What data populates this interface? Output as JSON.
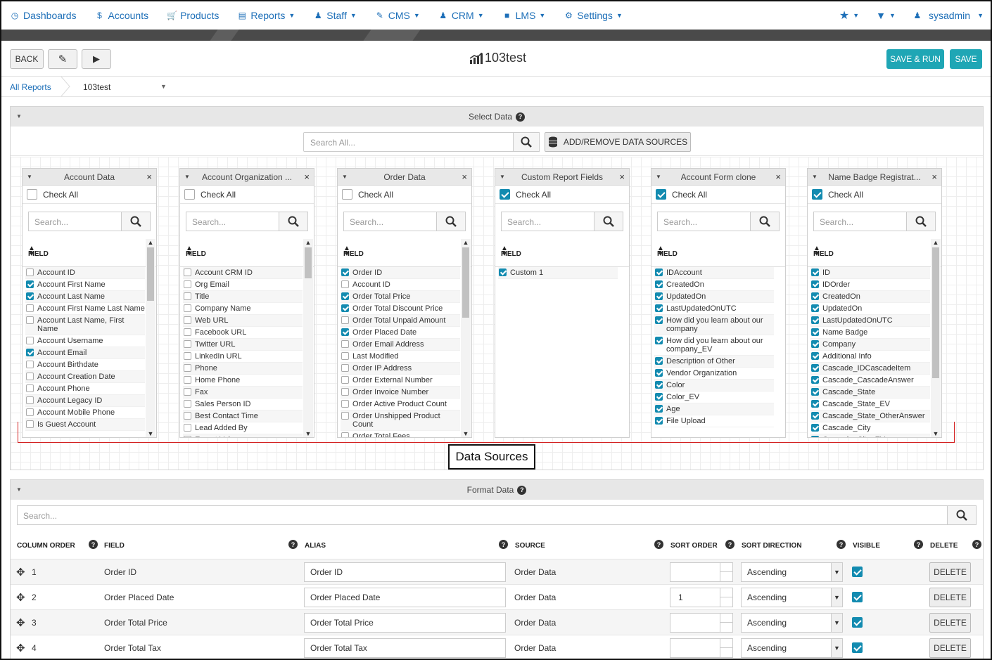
{
  "nav": {
    "items": [
      {
        "label": "Dashboards",
        "icon": "dashboard-icon",
        "dropdown": false
      },
      {
        "label": "Accounts",
        "icon": "dollar-icon",
        "dropdown": false
      },
      {
        "label": "Products",
        "icon": "cart-icon",
        "dropdown": false
      },
      {
        "label": "Reports",
        "icon": "chart-icon",
        "dropdown": true
      },
      {
        "label": "Staff",
        "icon": "user-icon",
        "dropdown": true
      },
      {
        "label": "CMS",
        "icon": "pencil-icon",
        "dropdown": true
      },
      {
        "label": "CRM",
        "icon": "users-icon",
        "dropdown": true
      },
      {
        "label": "LMS",
        "icon": "book-icon",
        "dropdown": true
      },
      {
        "label": "Settings",
        "icon": "gear-icon",
        "dropdown": true
      }
    ],
    "user": "sysadmin"
  },
  "toolbar": {
    "back_label": "BACK",
    "title": "103test",
    "save_run_label": "SAVE & RUN",
    "save_label": "SAVE"
  },
  "breadcrumb": {
    "root": "All Reports",
    "current": "103test"
  },
  "select_data": {
    "title": "Select Data",
    "search_placeholder": "Search All...",
    "add_remove_label": "ADD/REMOVE DATA SOURCES",
    "check_all_label": "Check All",
    "search_placeholder_small": "Search...",
    "field_header": "FIELD",
    "sources": [
      {
        "title": "Account Data",
        "check_all": false,
        "fields": [
          {
            "label": "Account ID",
            "checked": false
          },
          {
            "label": "Account First Name",
            "checked": true
          },
          {
            "label": "Account Last Name",
            "checked": true
          },
          {
            "label": "Account First Name Last Name",
            "checked": false
          },
          {
            "label": "Account Last Name, First Name",
            "checked": false
          },
          {
            "label": "Account Username",
            "checked": false
          },
          {
            "label": "Account Email",
            "checked": true
          },
          {
            "label": "Account Birthdate",
            "checked": false
          },
          {
            "label": "Account Creation Date",
            "checked": false
          },
          {
            "label": "Account Phone",
            "checked": false
          },
          {
            "label": "Account Legacy ID",
            "checked": false
          },
          {
            "label": "Account Mobile Phone",
            "checked": false
          },
          {
            "label": "Is Guest Account",
            "checked": false
          }
        ]
      },
      {
        "title": "Account Organization ...",
        "check_all": false,
        "fields": [
          {
            "label": "Account CRM ID",
            "checked": false
          },
          {
            "label": "Org Email",
            "checked": false
          },
          {
            "label": "Title",
            "checked": false
          },
          {
            "label": "Company Name",
            "checked": false
          },
          {
            "label": "Web URL",
            "checked": false
          },
          {
            "label": "Facebook URL",
            "checked": false
          },
          {
            "label": "Twitter URL",
            "checked": false
          },
          {
            "label": "LinkedIn URL",
            "checked": false
          },
          {
            "label": "Phone",
            "checked": false
          },
          {
            "label": "Home Phone",
            "checked": false
          },
          {
            "label": "Fax",
            "checked": false
          },
          {
            "label": "Sales Person ID",
            "checked": false
          },
          {
            "label": "Best Contact Time",
            "checked": false
          },
          {
            "label": "Lead Added By",
            "checked": false
          },
          {
            "label": "Export Value",
            "checked": false
          }
        ]
      },
      {
        "title": "Order Data",
        "check_all": false,
        "fields": [
          {
            "label": "Order ID",
            "checked": true
          },
          {
            "label": "Account ID",
            "checked": false
          },
          {
            "label": "Order Total Price",
            "checked": true
          },
          {
            "label": "Order Total Discount Price",
            "checked": true
          },
          {
            "label": "Order Total Unpaid Amount",
            "checked": false
          },
          {
            "label": "Order Placed Date",
            "checked": true
          },
          {
            "label": "Order Email Address",
            "checked": false
          },
          {
            "label": "Last Modified",
            "checked": false
          },
          {
            "label": "Order IP Address",
            "checked": false
          },
          {
            "label": "Order External Number",
            "checked": false
          },
          {
            "label": "Order Invoice Number",
            "checked": false
          },
          {
            "label": "Order Active Product Count",
            "checked": false
          },
          {
            "label": "Order Unshipped Product Count",
            "checked": false
          },
          {
            "label": "Order Total Fees",
            "checked": false
          }
        ]
      },
      {
        "title": "Custom Report Fields",
        "check_all": true,
        "fields": [
          {
            "label": "Custom 1",
            "checked": true
          }
        ]
      },
      {
        "title": "Account Form clone",
        "check_all": true,
        "fields": [
          {
            "label": "IDAccount",
            "checked": true
          },
          {
            "label": "CreatedOn",
            "checked": true
          },
          {
            "label": "UpdatedOn",
            "checked": true
          },
          {
            "label": "LastUpdatedOnUTC",
            "checked": true
          },
          {
            "label": "How did you learn about our company",
            "checked": true
          },
          {
            "label": "How did you learn about our company_EV",
            "checked": true
          },
          {
            "label": "Description of Other",
            "checked": true
          },
          {
            "label": "Vendor Organization",
            "checked": true
          },
          {
            "label": "Color",
            "checked": true
          },
          {
            "label": "Color_EV",
            "checked": true
          },
          {
            "label": "Age",
            "checked": true
          },
          {
            "label": "File Upload",
            "checked": true
          }
        ]
      },
      {
        "title": "Name Badge Registrat...",
        "check_all": true,
        "fields": [
          {
            "label": "ID",
            "checked": true
          },
          {
            "label": "IDOrder",
            "checked": true
          },
          {
            "label": "CreatedOn",
            "checked": true
          },
          {
            "label": "UpdatedOn",
            "checked": true
          },
          {
            "label": "LastUpdatedOnUTC",
            "checked": true
          },
          {
            "label": "Name Badge",
            "checked": true
          },
          {
            "label": "Company",
            "checked": true
          },
          {
            "label": "Additional Info",
            "checked": true
          },
          {
            "label": "Cascade_IDCascadeItem",
            "checked": true
          },
          {
            "label": "Cascade_CascadeAnswer",
            "checked": true
          },
          {
            "label": "Cascade_State",
            "checked": true
          },
          {
            "label": "Cascade_State_EV",
            "checked": true
          },
          {
            "label": "Cascade_State_OtherAnswer",
            "checked": true
          },
          {
            "label": "Cascade_City",
            "checked": true
          },
          {
            "label": "Cascade_City_EV",
            "checked": true
          }
        ]
      }
    ],
    "annotation": "Data Sources"
  },
  "format_data": {
    "title": "Format Data",
    "search_placeholder": "Search...",
    "columns": {
      "column_order": "COLUMN ORDER",
      "field": "FIELD",
      "alias": "ALIAS",
      "source": "SOURCE",
      "sort_order": "SORT ORDER",
      "sort_direction": "SORT DIRECTION",
      "visible": "VISIBLE",
      "delete": "DELETE"
    },
    "rows": [
      {
        "order": "1",
        "field": "Order ID",
        "alias": "Order ID",
        "source": "Order Data",
        "sort_order": "",
        "sort_direction": "Ascending",
        "visible": true,
        "delete_label": "DELETE"
      },
      {
        "order": "2",
        "field": "Order Placed Date",
        "alias": "Order Placed Date",
        "source": "Order Data",
        "sort_order": "1",
        "sort_direction": "Ascending",
        "visible": true,
        "delete_label": "DELETE"
      },
      {
        "order": "3",
        "field": "Order Total Price",
        "alias": "Order Total Price",
        "source": "Order Data",
        "sort_order": "",
        "sort_direction": "Ascending",
        "visible": true,
        "delete_label": "DELETE"
      },
      {
        "order": "4",
        "field": "Order Total Tax",
        "alias": "Order Total Tax",
        "source": "Order Data",
        "sort_order": "",
        "sort_direction": "Ascending",
        "visible": true,
        "delete_label": "DELETE"
      }
    ]
  },
  "colors": {
    "link": "#1d6fb8",
    "accent": "#1fa6b5",
    "checkbox": "#138bb0",
    "annotation": "#d32020"
  }
}
